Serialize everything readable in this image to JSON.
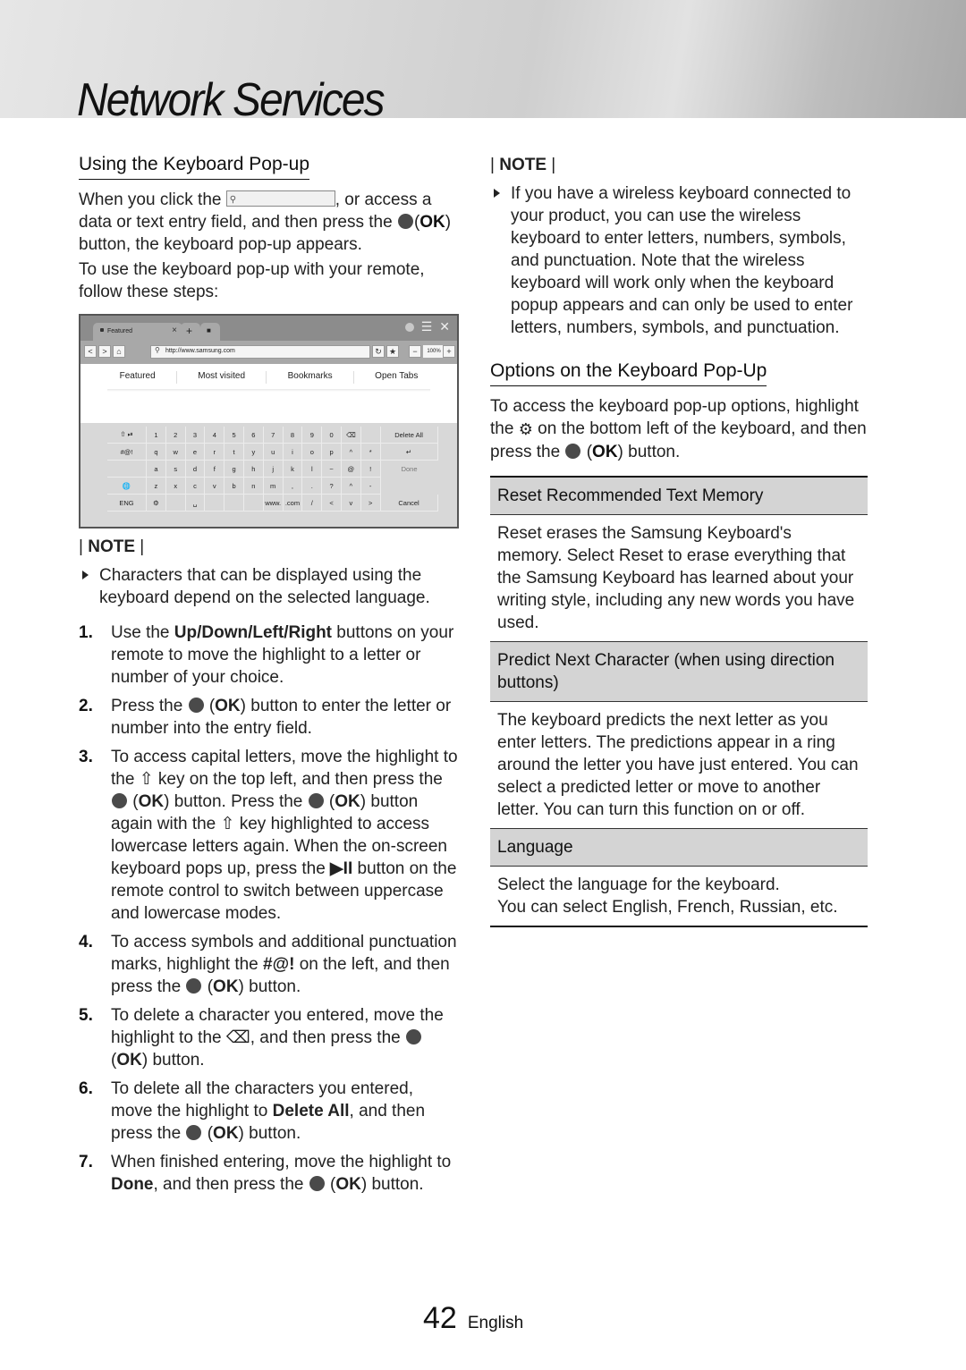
{
  "banner": {
    "title": "Network Services"
  },
  "left": {
    "heading": "Using the Keyboard Pop-up",
    "intro": {
      "part1": "When you click the",
      "part2": ", or access a data or text entry field, and then press the",
      "ok": "OK",
      "part3": "button, the keyboard pop-up appears."
    },
    "intro2": "To use the keyboard pop-up with your remote, follow these steps:",
    "browser": {
      "tab_label": "Featured",
      "tab_close": "×",
      "new_tab": "+",
      "url": "http://www.samsung.com",
      "zoom": "100%",
      "zoom_minus": "−",
      "zoom_plus": "+",
      "back": "<",
      "forward": ">",
      "nav_tabs": [
        "Featured",
        "Most visited",
        "Bookmarks",
        "Open Tabs"
      ]
    },
    "keyboard": {
      "rows": [
        [
          "⇧ ⏯",
          "1",
          "2",
          "3",
          "4",
          "5",
          "6",
          "7",
          "8",
          "9",
          "0",
          "⌫",
          "",
          "Delete All"
        ],
        [
          "#@!",
          "q",
          "w",
          "e",
          "r",
          "t",
          "y",
          "u",
          "i",
          "o",
          "p",
          "^",
          "*",
          "↵"
        ],
        [
          "",
          "a",
          "s",
          "d",
          "f",
          "g",
          "h",
          "j",
          "k",
          "l",
          "~",
          "@",
          "!",
          "Done"
        ],
        [
          "🌐",
          "z",
          "x",
          "c",
          "v",
          "b",
          "n",
          "m",
          ",",
          ".",
          "?",
          "^",
          "-",
          ""
        ],
        [
          "ENG",
          "⚙",
          "",
          "␣",
          "",
          "",
          "",
          "www.",
          ".com",
          "/",
          "<",
          "v",
          ">",
          "Cancel"
        ]
      ]
    },
    "note": {
      "label": "NOTE",
      "items": [
        "Characters that can be displayed using the keyboard depend on the selected language."
      ]
    },
    "steps": [
      {
        "num": "1.",
        "pre": "Use the ",
        "bold": "Up/Down/Left/Right",
        "post": " buttons on your remote to move the highlight to a letter or number of your choice."
      },
      {
        "num": "2.",
        "pre": "Press the",
        "ok": "OK",
        "post": "button to enter the letter or number into the entry field."
      },
      {
        "num": "3.",
        "a": "To access capital letters, move the highlight to the",
        "b": "key on the top left, and then press the",
        "c": "button. Press the",
        "d": "button again with the",
        "e": "key highlighted to access lowercase letters again. When the on-screen keyboard pops up, press the",
        "play": "▶II",
        "f": "button on the remote control to switch between uppercase and lowercase modes.",
        "ok": "OK"
      },
      {
        "num": "4.",
        "pre": "To access symbols and additional punctuation marks, highlight the ",
        "bold": "#@!",
        "mid": " on the left, and then press the",
        "ok": "OK",
        "post": "button."
      },
      {
        "num": "5.",
        "pre": "To delete a character you entered, move the highlight to the",
        "icon": "⌫",
        "mid": ", and then press the",
        "ok": "OK",
        "post": "button."
      },
      {
        "num": "6.",
        "pre": "To delete all the characters you entered, move the highlight to ",
        "bold": "Delete All",
        "mid": ", and then press the",
        "ok": "OK",
        "post": "button."
      },
      {
        "num": "7.",
        "pre": "When finished entering, move the highlight to ",
        "bold": "Done",
        "mid": ", and then press the",
        "ok": "OK",
        "post": "button."
      }
    ]
  },
  "right": {
    "note": {
      "label": "NOTE",
      "items": [
        "If you have a wireless keyboard connected to your product, you can use the wireless keyboard to enter letters, numbers, symbols, and punctuation. Note that the wireless keyboard will work only when the keyboard popup appears and can only be used to enter letters, numbers, symbols, and punctuation."
      ]
    },
    "heading": "Options on the Keyboard Pop-Up",
    "intro": {
      "part1": "To access the keyboard pop-up options, highlight the",
      "part2": "on the bottom left of the keyboard, and then press the",
      "ok": "OK",
      "part3": "button."
    },
    "options": [
      {
        "title": "Reset Recommended Text Memory",
        "body": "Reset erases the Samsung Keyboard's memory. Select Reset to erase everything that the Samsung Keyboard has learned about your writing style, including any new words you have used."
      },
      {
        "title": "Predict Next Character (when using direction buttons)",
        "body": "The keyboard predicts the next letter as you enter letters. The predictions appear in a ring around the letter you have just entered. You can select a predicted letter or move to another letter. You can turn this function on or off."
      },
      {
        "title": "Language",
        "body": "Select the language for the keyboard.",
        "body2": "You can select English, French, Russian, etc."
      }
    ]
  },
  "footer": {
    "page": "42",
    "language": "English"
  }
}
